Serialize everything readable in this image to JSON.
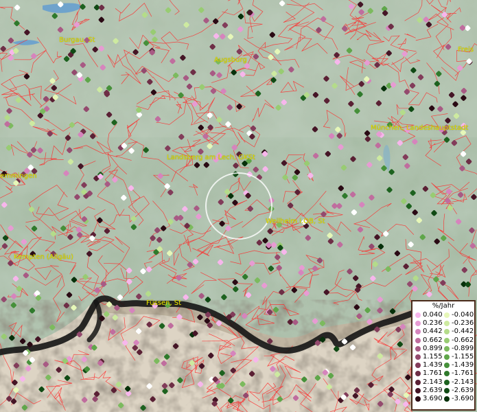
{
  "legend": {
    "title": "%/Jahr",
    "positive": [
      {
        "label": "0.040",
        "color": "#f7b6ec"
      },
      {
        "label": "0.236",
        "color": "#e79bd3"
      },
      {
        "label": "0.442",
        "color": "#d684bd"
      },
      {
        "label": "0.662",
        "color": "#c06d9e"
      },
      {
        "label": "0.899",
        "color": "#a85a84"
      },
      {
        "label": "1.155",
        "color": "#944a6e"
      },
      {
        "label": "1.439",
        "color": "#823c5a"
      },
      {
        "label": "1.761",
        "color": "#6e2e46"
      },
      {
        "label": "2.143",
        "color": "#5a2034"
      },
      {
        "label": "2.639",
        "color": "#451526"
      },
      {
        "label": "3.690",
        "color": "#2a0a14"
      }
    ],
    "negative": [
      {
        "label": "-0.040",
        "color": "#e6f7b8"
      },
      {
        "label": "-0.236",
        "color": "#cdeaa0"
      },
      {
        "label": "-0.442",
        "color": "#b4dc8a"
      },
      {
        "label": "-0.662",
        "color": "#98cc72"
      },
      {
        "label": "-0.899",
        "color": "#7cba5e"
      },
      {
        "label": "-1.155",
        "color": "#5fa64a"
      },
      {
        "label": "-1.439",
        "color": "#46903a"
      },
      {
        "label": "-1.761",
        "color": "#2f7a2c"
      },
      {
        "label": "-2.143",
        "color": "#1d621f"
      },
      {
        "label": "-2.639",
        "color": "#104a14"
      },
      {
        "label": "-3.690",
        "color": "#06300a"
      }
    ]
  },
  "cities": [
    {
      "id": "burgau",
      "label": "Burgau, St"
    },
    {
      "id": "augsburg",
      "label": "Augsburg"
    },
    {
      "id": "freising",
      "label": "Freis"
    },
    {
      "id": "muenchen",
      "label": "München, Landeshauptstadt"
    },
    {
      "id": "landsberg",
      "label": "Landsberg am Lech, GKSt"
    },
    {
      "id": "memmingen",
      "label": "emmingen"
    },
    {
      "id": "weilheim",
      "label": "Weilheim i.OB, St"
    },
    {
      "id": "kempten",
      "label": "Kempten (Allgäu)"
    },
    {
      "id": "fuessen",
      "label": "Füssen, St"
    }
  ],
  "colors": {
    "boundaries": "#ff2a2a",
    "terrain": "#a8bca8",
    "country_border": "#151515",
    "highlight_circle": "#ffffff"
  }
}
